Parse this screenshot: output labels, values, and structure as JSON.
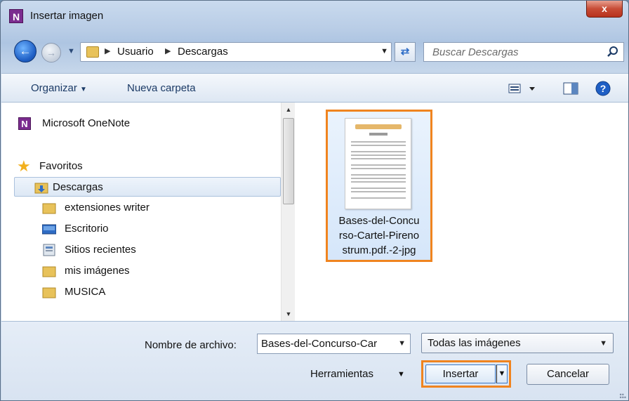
{
  "window": {
    "title": "Insertar imagen",
    "app_icon": "N",
    "close_glyph": "x"
  },
  "nav": {
    "breadcrumb": [
      "Usuario",
      "Descargas"
    ],
    "search_placeholder": "Buscar Descargas"
  },
  "toolbar": {
    "organize_label": "Organizar",
    "new_folder_label": "Nueva carpeta"
  },
  "sidebar": {
    "onenote": "Microsoft OneNote",
    "favorites_header": "Favoritos",
    "items": [
      {
        "label": "Descargas",
        "icon": "download-folder-icon",
        "selected": true
      },
      {
        "label": "extensiones writer",
        "icon": "folder-icon",
        "selected": false
      },
      {
        "label": "Escritorio",
        "icon": "desktop-icon",
        "selected": false
      },
      {
        "label": "Sitios recientes",
        "icon": "recent-places-icon",
        "selected": false
      },
      {
        "label": "mis imágenes",
        "icon": "folder-icon",
        "selected": false
      },
      {
        "label": "MUSICA",
        "icon": "folder-icon",
        "selected": false
      }
    ]
  },
  "files": [
    {
      "name_lines": [
        "Bases-del-Concu",
        "rso-Cartel-Pireno",
        "strum.pdf.-2-jpg"
      ]
    }
  ],
  "footer": {
    "filename_label": "Nombre de archivo:",
    "filename_value": "Bases-del-Concurso-Car",
    "filetype_value": "Todas las imágenes",
    "tools_label": "Herramientas",
    "insert_label": "Insertar",
    "cancel_label": "Cancelar"
  },
  "colors": {
    "highlight": "#f0841f",
    "accent": "#1f5fc5"
  }
}
